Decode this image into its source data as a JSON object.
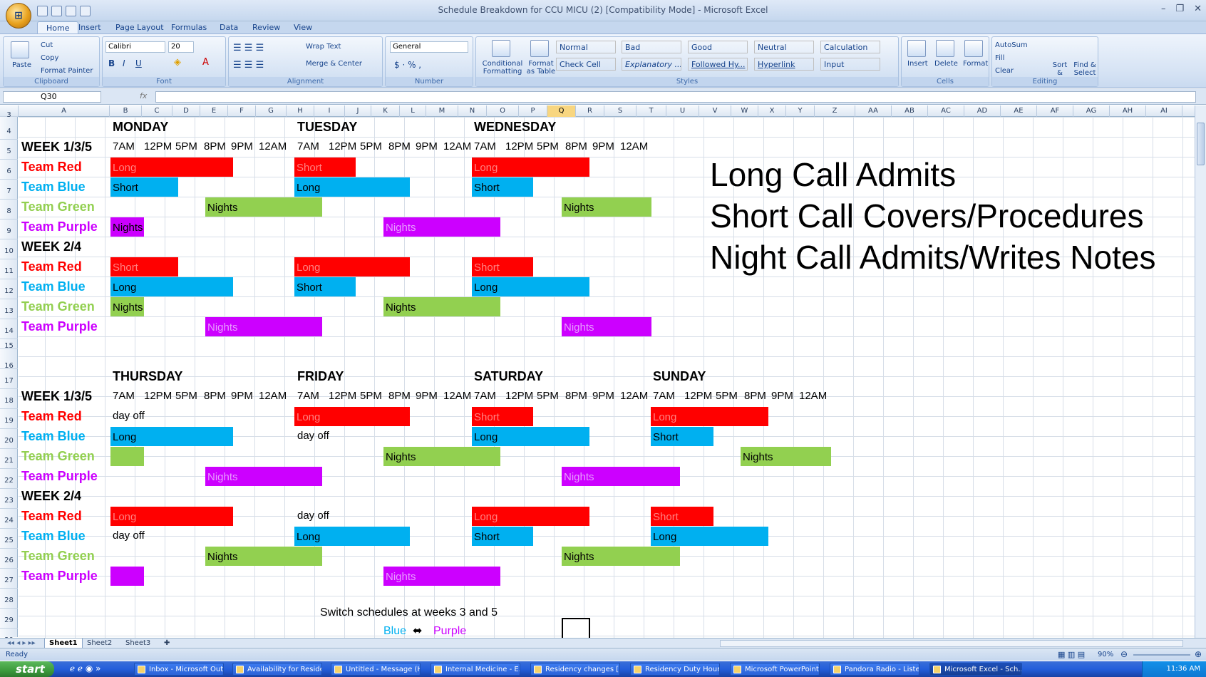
{
  "window": {
    "title": "Schedule Breakdown for CCU MICU (2)  [Compatibility Mode] - Microsoft Excel"
  },
  "office_button": {
    "label": "Office"
  },
  "tabs": [
    "Home",
    "Insert",
    "Page Layout",
    "Formulas",
    "Data",
    "Review",
    "View"
  ],
  "ribbon": {
    "clipboard": {
      "paste": "Paste",
      "cut": "Cut",
      "copy": "Copy",
      "format_painter": "Format Painter",
      "label": "Clipboard"
    },
    "font": {
      "name": "Calibri",
      "size": "20",
      "label": "Font"
    },
    "alignment": {
      "wrap": "Wrap Text",
      "merge": "Merge & Center",
      "label": "Alignment"
    },
    "number": {
      "format": "General",
      "label": "Number"
    },
    "styles": {
      "cond": "Conditional Formatting",
      "table": "Format as Table",
      "label": "Styles",
      "items": [
        {
          "name": "Normal",
          "bg": "#ffffff",
          "fg": "#000000"
        },
        {
          "name": "Bad",
          "bg": "#ffc7ce",
          "fg": "#9c0006"
        },
        {
          "name": "Good",
          "bg": "#c6efce",
          "fg": "#006100"
        },
        {
          "name": "Neutral",
          "bg": "#ffeb9c",
          "fg": "#9c6500"
        },
        {
          "name": "Calculation",
          "bg": "#f2f2f2",
          "fg": "#fa7d00"
        },
        {
          "name": "Check Cell",
          "bg": "#a5a5a5",
          "fg": "#ffffff"
        },
        {
          "name": "Explanatory ...",
          "bg": "#ffffff",
          "fg": "#7f7f7f"
        },
        {
          "name": "Followed Hy...",
          "bg": "#ffffff",
          "fg": "#800080"
        },
        {
          "name": "Hyperlink",
          "bg": "#ffffff",
          "fg": "#0000ff"
        },
        {
          "name": "Input",
          "bg": "#ffcc99",
          "fg": "#3f3f76"
        }
      ]
    },
    "cells": {
      "insert": "Insert",
      "delete": "Delete",
      "format": "Format",
      "label": "Cells"
    },
    "editing": {
      "autosum": "AutoSum",
      "fill": "Fill",
      "clear": "Clear",
      "sort": "Sort & Filter",
      "find": "Find & Select",
      "label": "Editing"
    }
  },
  "formula_bar": {
    "name_box": "Q30",
    "fx": "fx",
    "value": ""
  },
  "columns": [
    "A",
    "B",
    "C",
    "D",
    "E",
    "F",
    "G",
    "H",
    "I",
    "J",
    "K",
    "L",
    "M",
    "N",
    "O",
    "P",
    "Q",
    "R",
    "S",
    "T",
    "U",
    "V",
    "W",
    "X",
    "Y",
    "Z",
    "AA",
    "AB",
    "AC",
    "AD",
    "AE",
    "AF",
    "AG",
    "AH",
    "AI"
  ],
  "selected_column": "Q",
  "rows": [
    "3",
    "4",
    "5",
    "6",
    "7",
    "8",
    "9",
    "10",
    "11",
    "12",
    "13",
    "14",
    "15",
    "16",
    "17",
    "18",
    "19",
    "20",
    "21",
    "22",
    "23",
    "24",
    "25",
    "26",
    "27",
    "28",
    "29",
    "30"
  ],
  "colors": {
    "red": "#ff0000",
    "blue": "#00b0f0",
    "green": "#92d050",
    "purple": "#cc00ff",
    "team_red": "#ff0000",
    "team_blue": "#00b0f0",
    "team_green": "#92d050",
    "team_purple": "#cc00ff"
  },
  "sheet": {
    "days_top": [
      "MONDAY",
      "TUESDAY",
      "WEDNESDAY"
    ],
    "days_bottom": [
      "THURSDAY",
      "FRIDAY",
      "SATURDAY",
      "SUNDAY"
    ],
    "week135": "WEEK 1/3/5",
    "week24": "WEEK 2/4",
    "times": [
      "7AM",
      "12PM",
      "5PM",
      "8PM",
      "9PM",
      "12AM"
    ],
    "teams": [
      "Team Red",
      "Team Blue",
      "Team Green",
      "Team Purple"
    ],
    "labels": {
      "long": "Long",
      "short": "Short",
      "nights": "Nights",
      "dayoff": "day off"
    },
    "legend": [
      "Long Call Admits",
      "Short Call Covers/Procedures",
      "Night Call Admits/Writes Notes"
    ],
    "footer": {
      "switch": "Switch schedules at weeks 3 and 5",
      "blue": "Blue",
      "arrow": "⬌",
      "purple": "Purple"
    }
  },
  "sheet_tabs": [
    "Sheet1",
    "Sheet2",
    "Sheet3"
  ],
  "status": {
    "text": "Ready",
    "zoom": "90%"
  },
  "taskbar": {
    "start": "start",
    "items": [
      "Inbox - Microsoft Out...",
      "Availability for Reside...",
      "Untitled - Message (H...",
      "Internal Medicine - E...",
      "Residency changes [...",
      "Residency Duty Hour...",
      "Microsoft PowerPoint ...",
      "Pandora Radio - Liste...",
      "Microsoft Excel - Sch..."
    ],
    "clock": "11:36 AM"
  }
}
